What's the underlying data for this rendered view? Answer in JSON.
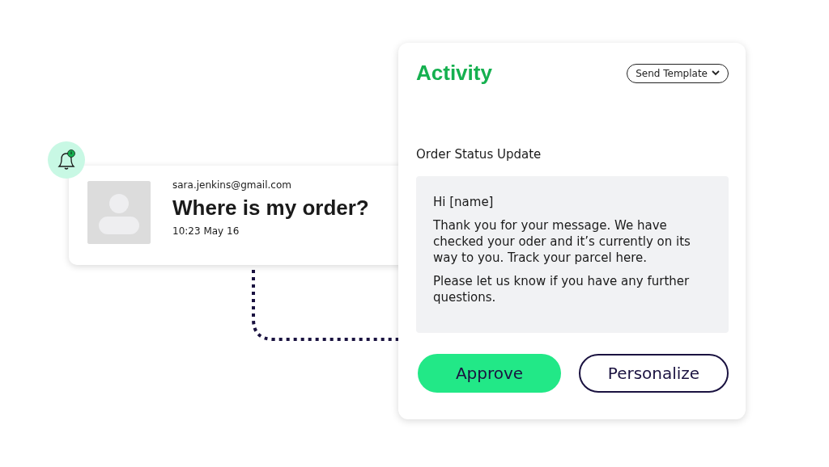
{
  "notification": {
    "email": "sara.jenkins@gmail.com",
    "subject": "Where is my order?",
    "time": "10:23 May 16"
  },
  "activity": {
    "title": "Activity",
    "template_button": "Send Template",
    "section_title": "Order Status Update",
    "message": [
      "Hi [name]",
      "Thank you for your message. We have checked your oder and it’s currently on its way to you. Track your parcel here.",
      "Please let us know if you have any further questions."
    ],
    "buttons": [
      {
        "label": "Approve",
        "kind": "primary"
      },
      {
        "label": "Personalize",
        "kind": "secondary"
      }
    ]
  }
}
